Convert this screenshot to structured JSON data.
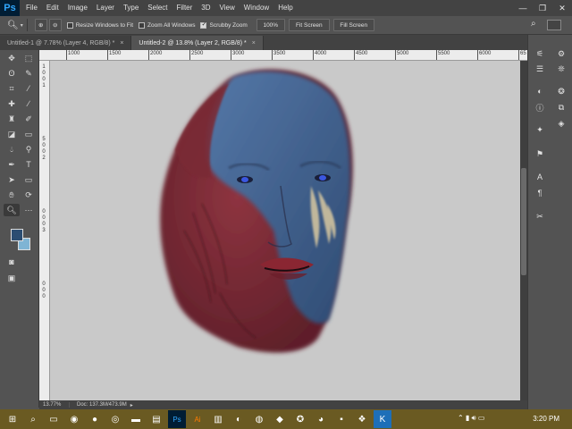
{
  "app": {
    "logo": "Ps"
  },
  "menu": [
    "File",
    "Edit",
    "Image",
    "Layer",
    "Type",
    "Select",
    "Filter",
    "3D",
    "View",
    "Window",
    "Help"
  ],
  "window_controls": {
    "minimize": "—",
    "restore": "❐",
    "close": "✕"
  },
  "options": {
    "resize_windows_label": "Resize Windows to Fit",
    "zoom_all_label": "Zoom All Windows",
    "scrubby_zoom_label": "Scrubby Zoom",
    "zoom_value": "100%",
    "fit_screen_label": "Fit Screen",
    "fill_screen_label": "Fill Screen"
  },
  "tabs": [
    {
      "label": "Untitled-1 @ 7.78% (Layer 4, RGB/8) *",
      "close": "×"
    },
    {
      "label": "Untitled-2 @ 13.8% (Layer 2, RGB/8) *",
      "close": "×"
    }
  ],
  "ruler_h": [
    "1000",
    "1500",
    "2000",
    "2500",
    "3000",
    "3500",
    "4000",
    "4500",
    "5000",
    "5500",
    "6000",
    "65"
  ],
  "ruler_v": [
    "1",
    "0",
    "0",
    "1",
    "5",
    "0",
    "0",
    "2",
    "0",
    "0",
    "0",
    "3",
    "0",
    "0",
    "0"
  ],
  "status": {
    "zoom": "13.77%",
    "doc": "Doc: 137.3M/473.9M",
    "arrow": "▸"
  },
  "colors": {
    "foreground": "#2b4d72",
    "background": "#7fb4d4",
    "face_red": "#7d2a35",
    "face_blue": "#3d5f8e"
  },
  "taskbar": {
    "time": "3:20 PM"
  }
}
